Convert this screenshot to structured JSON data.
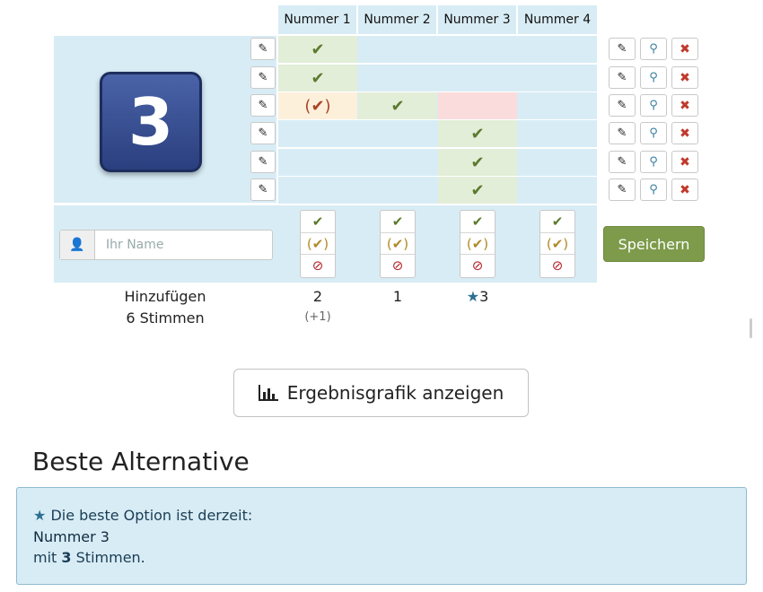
{
  "columns": [
    "Nummer 1",
    "Nummer 2",
    "Nummer 3",
    "Nummer 4"
  ],
  "poll_image_text": "3",
  "rows": [
    {
      "marks": [
        "ok",
        "",
        "",
        ""
      ]
    },
    {
      "marks": [
        "ok",
        "",
        "",
        ""
      ]
    },
    {
      "marks": [
        "maybe-red",
        "ok",
        "",
        ""
      ]
    },
    {
      "marks": [
        "",
        "",
        "ok",
        ""
      ]
    },
    {
      "marks": [
        "",
        "",
        "ok",
        ""
      ]
    },
    {
      "marks": [
        "",
        "",
        "ok",
        ""
      ]
    }
  ],
  "glyphs": {
    "ok": "✔",
    "maybe": "(✔)",
    "no": "⊘",
    "pencil": "✎",
    "link": "⚲",
    "del": "✖",
    "user": "👤",
    "chart": "📊",
    "star": "★"
  },
  "new_vote": {
    "placeholder": "Ihr Name",
    "save_label": "Speichern"
  },
  "summary": {
    "add_label": "Hinzufügen",
    "votes_label": "6 Stimmen",
    "counts": [
      "2",
      "1",
      "3",
      ""
    ],
    "extra": [
      "(+1)",
      "",
      "",
      ""
    ]
  },
  "chart_button": {
    "label": "Ergebnisgrafik anzeigen"
  },
  "best": {
    "heading": "Beste Alternative",
    "intro": "Die beste Option ist derzeit:",
    "option": "Nummer 3",
    "votes_prefix": "mit",
    "votes_count": "3",
    "votes_suffix": "Stimmen."
  },
  "colors": {
    "panel": "#d8ecf5",
    "yes": "#e2eed8",
    "maybe": "#fdf0db",
    "no": "#fbdcdc",
    "save": "#7d9b4b",
    "star": "#2d6f93"
  }
}
